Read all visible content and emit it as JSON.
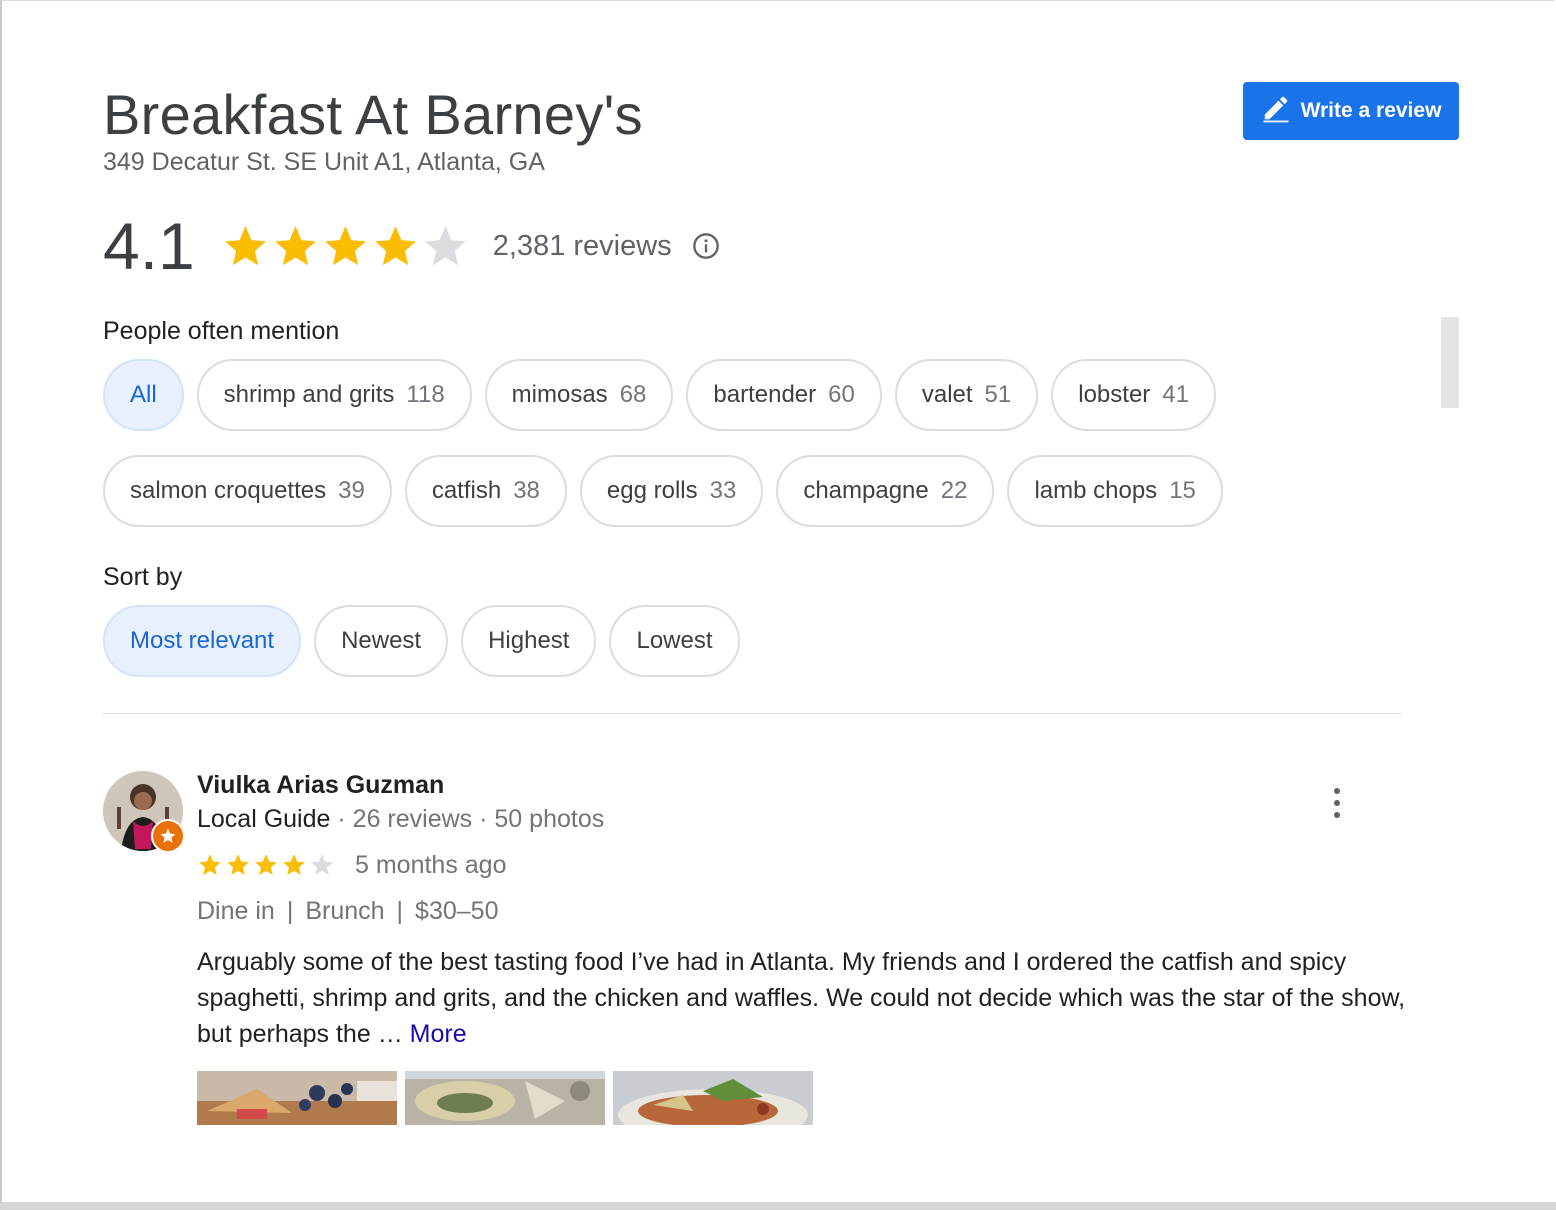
{
  "place": {
    "name": "Breakfast At Barney's",
    "address": "349 Decatur St. SE Unit A1, Atlanta, GA"
  },
  "write_review": {
    "label": "Write a review",
    "icon": "pencil-icon"
  },
  "rating": {
    "value": "4.1",
    "stars_value": 4.1,
    "stars_max": 5,
    "review_count": "2,381 reviews",
    "info_icon": "info-icon"
  },
  "mentions": {
    "label": "People often mention",
    "chips": [
      {
        "label": "All",
        "count": "",
        "selected": true
      },
      {
        "label": "shrimp and grits",
        "count": "118"
      },
      {
        "label": "mimosas",
        "count": "68"
      },
      {
        "label": "bartender",
        "count": "60"
      },
      {
        "label": "valet",
        "count": "51"
      },
      {
        "label": "lobster",
        "count": "41"
      },
      {
        "label": "salmon croquettes",
        "count": "39"
      },
      {
        "label": "catfish",
        "count": "38"
      },
      {
        "label": "egg rolls",
        "count": "33"
      },
      {
        "label": "champagne",
        "count": "22"
      },
      {
        "label": "lamb chops",
        "count": "15"
      }
    ]
  },
  "sort": {
    "label": "Sort by",
    "options": [
      {
        "label": "Most relevant",
        "selected": true
      },
      {
        "label": "Newest"
      },
      {
        "label": "Highest"
      },
      {
        "label": "Lowest"
      }
    ]
  },
  "review": {
    "author": "Viulka Arias Guzman",
    "badge": "Local Guide",
    "sep": "·",
    "reviews": "26 reviews",
    "photos": "50 photos",
    "stars": 4,
    "time": "5 months ago",
    "tags": [
      "Dine in",
      "Brunch",
      "$30–50"
    ],
    "tag_sep": "|",
    "text": "Arguably some of the best tasting food I’ve had in Atlanta. My friends and I ordered the catfish and spicy spaghetti, shrimp and grits, and the chicken and waffles. We could not decide which was the star of the show, but perhaps the …",
    "more": "More"
  },
  "colors": {
    "accent": "#1a73e8",
    "star": "#fbbc04",
    "star_empty": "#dadce0",
    "chip_selected_bg": "#e8f0fe",
    "chip_selected_text": "#1967d2",
    "link": "#1a0dab"
  }
}
